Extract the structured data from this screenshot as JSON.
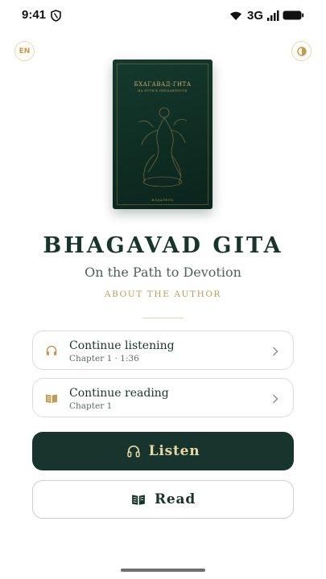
{
  "status_bar": {
    "time": "9:41",
    "network": "3G",
    "icons": [
      "shield-icon",
      "wifi-icon",
      "signal-icon",
      "battery-icon"
    ]
  },
  "header": {
    "language_label": "EN",
    "theme_icon": "half-circle-contrast-icon"
  },
  "cover": {
    "title": "БХАГАВАД-ГИТА",
    "subtitle": "НА ПУТИ К ПРЕДАННОСТИ",
    "footer": "ИЗДАТЕЛЬ"
  },
  "book": {
    "title": "BHAGAVAD GITA",
    "subtitle": "On the Path to Devotion",
    "about_link": "ABOUT THE AUTHOR"
  },
  "continue_listening": {
    "title": "Continue listening",
    "meta": "Chapter 1 · 1:36",
    "icon": "headphones-icon"
  },
  "continue_reading": {
    "title": "Continue reading",
    "meta": "Chapter 1",
    "icon": "open-book-icon"
  },
  "actions": {
    "listen_label": "Listen",
    "read_label": "Read"
  },
  "colors": {
    "primary_dark_green": "#17352c",
    "accent_gold": "#c49a52",
    "listen_text": "#ead7a6"
  }
}
